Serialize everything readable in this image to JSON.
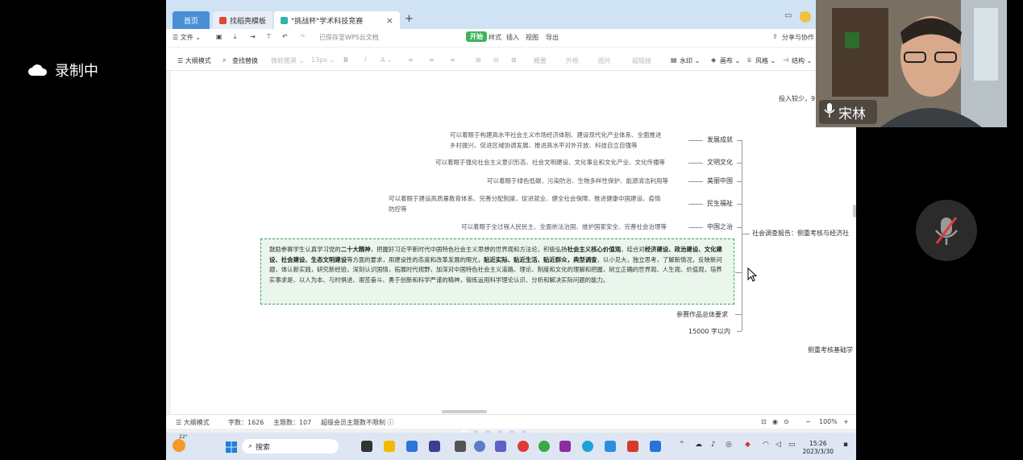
{
  "recording": {
    "label": "录制中"
  },
  "browser": {
    "tabs": [
      {
        "label": "首页"
      },
      {
        "label": "找稻壳模板"
      },
      {
        "label": "\"挑战杯\"学术科技竞赛"
      }
    ],
    "new_tab": "+",
    "close": "×"
  },
  "menubar": {
    "file": "☰ 文件 ⌄",
    "saved": "已保存至WPS云文档",
    "items": [
      "开始",
      "样式",
      "插入",
      "视图",
      "导出"
    ],
    "share": "分享与协作"
  },
  "fmtbar": {
    "outline_mode": "☰ 大纲模式",
    "find_replace": "查找替换",
    "font": "微软雅黑 ⌄",
    "size": "13px ⌄",
    "bold": "B",
    "italic": "I",
    "color": "A ⌄",
    "summary": "概要",
    "frame": "外框",
    "image": "图片",
    "link": "超链接",
    "watermark": "水印 ⌄",
    "canvas": "画布 ⌄",
    "style": "风格 ⌄",
    "structure": "结构 ⌄"
  },
  "mindmap": {
    "branches": [
      {
        "label": "发展成就",
        "text": [
          "可以着眼于构建高水平社会主义市场经济体制、建设现代化产业体系、全面推进",
          "乡村振兴、促进区域协调发展、推进高水平对外开放、科技自立自强等"
        ]
      },
      {
        "label": "文明文化",
        "text": [
          "可以着眼于强化社会主义意识形态、社会文明建设、文化事业和文化产业、文化传播等"
        ]
      },
      {
        "label": "美丽中国",
        "text": [
          "可以着眼于绿色低碳、污染防治、生物多样性保护、能源清洁利用等"
        ]
      },
      {
        "label": "民生福祉",
        "text": [
          "可以着眼于建设高质量教育体系、完善分配制度、促进就业、健全社会保障、推进健康中国建设、疫情",
          "防控等"
        ]
      },
      {
        "label": "中国之治",
        "text": [
          "可以着眼于全过程人民民主、全面依法治国、维护国家安全、完善社会治理等"
        ]
      }
    ],
    "parent_node": "社会调查报告：侧重考核与经济社",
    "top_right_fragment": "投入较少，9",
    "bottom_right_fragment": "侧重考核基础学",
    "selected_node": {
      "segments": [
        {
          "t": "鼓励参赛学生认真学习党的",
          "b": false
        },
        {
          "t": "二十大精神",
          "b": true
        },
        {
          "t": "，把握好习近平新时代中国特色社会主义思想的世界观和方法论，积极弘扬",
          "b": false
        },
        {
          "t": "社会主义核心价值观",
          "b": true
        },
        {
          "t": "，结合对",
          "b": false
        },
        {
          "t": "经济建设、政治建设、文化建设、社会建设、生态文明建设",
          "b": true
        },
        {
          "t": "等方面的要求，用建设性的态度和改革发展的眼光，",
          "b": false
        },
        {
          "t": "贴近实际、贴近生活、贴近群众，典型调查",
          "b": true
        },
        {
          "t": "，以小见大，独立思考，了解新情况，反映新问题，体认新实践，研究新经验，深刻认识国情，拓展时代视野，加深对中国特色社会主义道路、理论、制度和文化的理解和把握，树立正确的世界观、人生观、价值观，培养实事求是、以人为本、与时俱进、艰苦奋斗、勇于创新和科学严谨的精神，锻炼运用科学理论认识、分析和解决实际问题的能力。",
          "b": false
        }
      ]
    },
    "req_node": "参赛作品总体要求",
    "words_node": "15000 字以内"
  },
  "statusbar": {
    "outline": "☰ 大纲模式",
    "word_count": "字数：1626",
    "topic_count": "主题数：107",
    "vip": "超级会员主题数不限制 ⓘ",
    "zoom": "100%",
    "minus": "−",
    "plus": "+"
  },
  "taskbar": {
    "weather": "22°",
    "search": "搜索",
    "time": "15:26",
    "date": "2023/3/30"
  },
  "webcam": {
    "name": "宋林"
  },
  "colors": {
    "accent": "#3fb55a",
    "tab_active": "#4a8fd6",
    "selection": "#3fa55d"
  }
}
